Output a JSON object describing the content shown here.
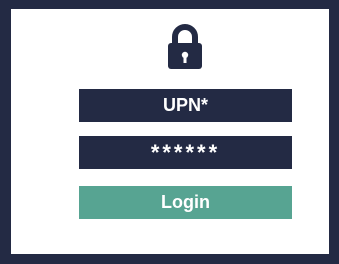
{
  "colors": {
    "navy": "#232a44",
    "accent": "#57a492",
    "panel": "#ffffff"
  },
  "lock": {
    "icon": "lock-icon"
  },
  "form": {
    "upn_value": "UPN*",
    "password_value": "******",
    "login_label": "Login"
  }
}
